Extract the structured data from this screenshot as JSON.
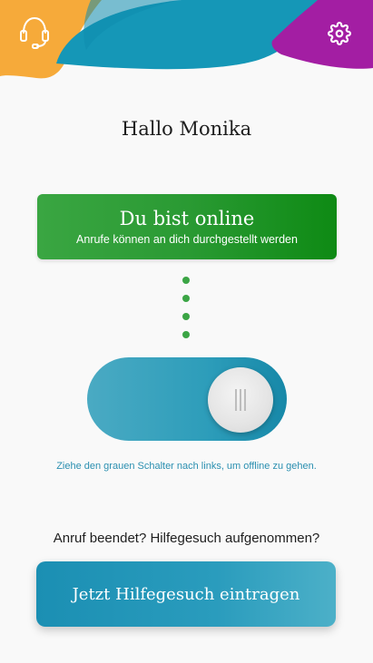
{
  "header": {
    "left_icon": "headset-icon",
    "right_icon": "gear-icon",
    "colors": {
      "orange": "#f7ab3b",
      "teal": "#1597b7",
      "magenta": "#a51ea3"
    }
  },
  "greeting": "Hallo Monika",
  "status": {
    "title": "Du bist online",
    "subtitle": "Anrufe können an dich durchgestellt werden",
    "color": "#2a9a33"
  },
  "toggle": {
    "state": "online",
    "hint": "Ziehe den grauen Schalter nach links, um offline zu gehen."
  },
  "question": "Anruf beendet? Hilfegesuch aufgenommen?",
  "cta_label": "Jetzt Hilfegesuch eintragen"
}
